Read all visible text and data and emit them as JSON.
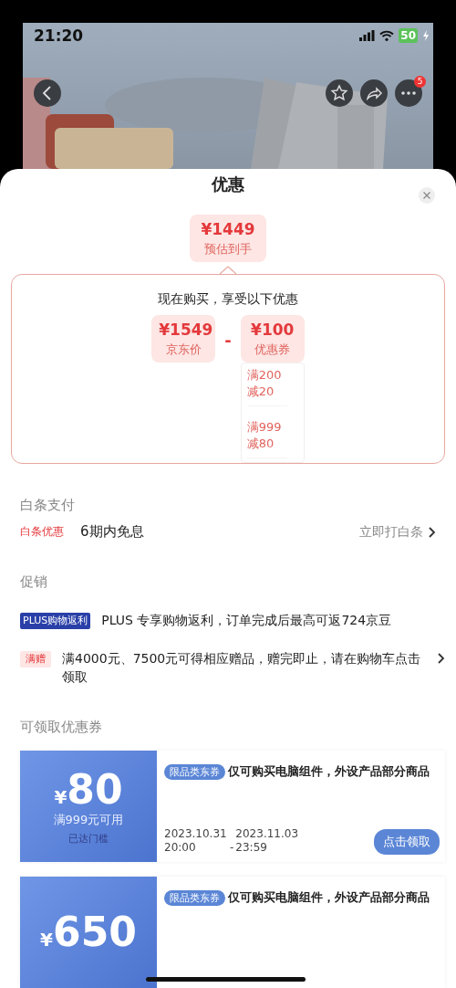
{
  "status_bar": {
    "time": "21:20",
    "battery": "50"
  },
  "nav": {
    "badge": "5"
  },
  "sheet": {
    "title": "优惠"
  },
  "estimate": {
    "price": "¥1449",
    "label": "预估到手"
  },
  "breakdown": {
    "heading": "现在购买，享受以下优惠",
    "operator": "-",
    "items": [
      {
        "price": "¥1549",
        "label": "京东价"
      },
      {
        "price": "¥100",
        "label": "优惠券",
        "rules": [
          "满200减20",
          "满999减80"
        ]
      }
    ]
  },
  "baitiao": {
    "heading": "白条支付",
    "tag": "白条优惠",
    "text": "6期内免息",
    "link": "立即打白条"
  },
  "promotions": {
    "heading": "促销",
    "items": [
      {
        "kind": "plus",
        "tag": "PLUS购物返利",
        "text": "PLUS 专享购物返利，订单完成后最高可返724京豆",
        "chevron": false
      },
      {
        "kind": "gift",
        "tag": "满赠",
        "text": "满4000元、7500元可得相应赠品，赠完即止，请在购物车点击领取",
        "chevron": true
      }
    ]
  },
  "coupons": {
    "heading": "可领取优惠券",
    "items": [
      {
        "currency": "¥",
        "amount": "80",
        "condition": "满999元可用",
        "status": "已达门槛",
        "tag": "限品类东券",
        "description": "仅可购买电脑组件，外设产品部分商品",
        "start": "2023.10.31 20:00",
        "separator": "-",
        "end": "2023.11.03 23:59",
        "button": "点击领取"
      },
      {
        "currency": "¥",
        "amount": "650",
        "tag": "限品类东券",
        "description": "仅可购买电脑组件，外设产品部分商品"
      }
    ]
  }
}
